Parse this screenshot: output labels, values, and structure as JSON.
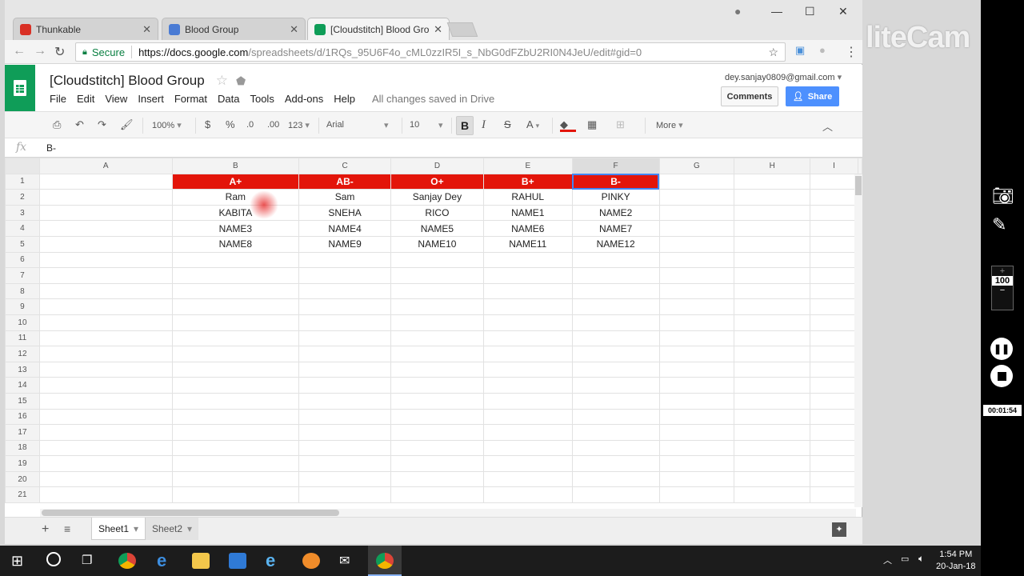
{
  "tabs": [
    {
      "title": "Thunkable",
      "color": "#d93025"
    },
    {
      "title": "Blood Group",
      "color": "#4a7bd4"
    },
    {
      "title": "[Cloudstitch] Blood Grou",
      "color": "#0f9d58"
    }
  ],
  "address": {
    "secure_label": "Secure",
    "domain": "https://docs.google.com",
    "path": "/spreadsheets/d/1RQs_95U6F4o_cML0zzIR5I_s_NbG0dFZbU2RI0N4JeU/edit#gid=0"
  },
  "doc": {
    "title": "[Cloudstitch] Blood Group",
    "account": "dey.sanjay0809@gmail.com",
    "comments_label": "Comments",
    "share_label": "Share",
    "saved_status": "All changes saved in Drive"
  },
  "menu": [
    "File",
    "Edit",
    "View",
    "Insert",
    "Format",
    "Data",
    "Tools",
    "Add-ons",
    "Help"
  ],
  "toolbar": {
    "zoom": "100%",
    "currency": "$",
    "percent": "%",
    "dec_down": ".0",
    "dec_up": ".00",
    "format": "123",
    "font": "Arial",
    "size": "10",
    "bold": "B",
    "italic": "I",
    "strike": "S",
    "textcolor": "A",
    "more": "More"
  },
  "formula": {
    "fx": "fx",
    "value": "B-"
  },
  "grid": {
    "columns": [
      "A",
      "B",
      "C",
      "D",
      "E",
      "F",
      "G",
      "H",
      "I"
    ],
    "rows": [
      [
        "",
        "A+",
        "AB-",
        "O+",
        "B+",
        "B-",
        "",
        "",
        ""
      ],
      [
        "",
        "Ram",
        "Sam",
        "Sanjay Dey",
        "RAHUL",
        "PINKY",
        "",
        "",
        ""
      ],
      [
        "",
        "KABITA",
        "SNEHA",
        "RICO",
        "NAME1",
        "NAME2",
        "",
        "",
        ""
      ],
      [
        "",
        "NAME3",
        "NAME4",
        "NAME5",
        "NAME6",
        "NAME7",
        "",
        "",
        ""
      ],
      [
        "",
        "NAME8",
        "NAME9",
        "NAME10",
        "NAME11",
        "NAME12",
        "",
        "",
        ""
      ]
    ],
    "row_count": 21,
    "header_color": "#e3150a"
  },
  "sheets": [
    "Sheet1",
    "Sheet2"
  ],
  "taskbar": {
    "time": "1:54 PM",
    "date": "20-Jan-18"
  },
  "recorder": {
    "brand": "liteCam",
    "zoom": "100",
    "timer": "00:01:54"
  }
}
